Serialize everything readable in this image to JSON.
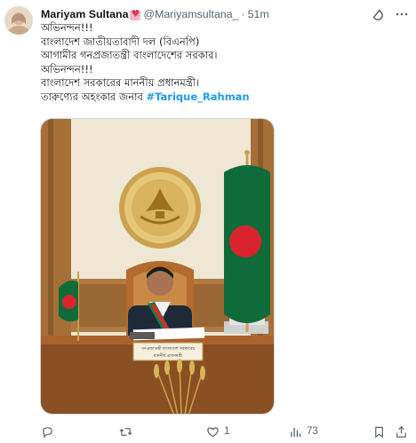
{
  "author": {
    "name": "Mariyam Sultana",
    "handle": "@Mariyamsultana_",
    "separator": "·",
    "time": "51m"
  },
  "tweet": {
    "lines": [
      "অভিনন্দন!!!",
      "বাংলাদেশ জাতীয়তাবাদী দল (বিএনপি)",
      "আগামীর গনপ্রজাতন্ত্রী বাংলাদেশের সরকার।",
      "অভিনন্দন!!!",
      "বাংলাদেশ সরকারের মাননীয় প্রধানমন্ত্রী।",
      "তারুণ্যের অহংকার জনাব"
    ],
    "hashtag": "#Tarique_Rahman"
  },
  "media": {
    "emblem_text": "গণপ্রজাতন্ত্রী বাংলাদেশ সরকার",
    "nameplate_line1": "গণপ্রজাতন্ত্রী বাংলাদেশ সরকারের",
    "nameplate_line2": "মাননীয় প্রধানমন্ত্রী"
  },
  "actions": {
    "replies": "",
    "retweets": "",
    "likes": "1",
    "views": "73"
  },
  "colors": {
    "accent": "#1d9bf0",
    "muted": "#536471",
    "flag_green": "#006a4e",
    "flag_red": "#e42a38"
  },
  "icons": {
    "grok": "grok-icon",
    "more": "more-icon",
    "reply": "reply-icon",
    "retweet": "retweet-icon",
    "like": "heart-icon",
    "views": "views-icon",
    "share": "share-icon"
  }
}
